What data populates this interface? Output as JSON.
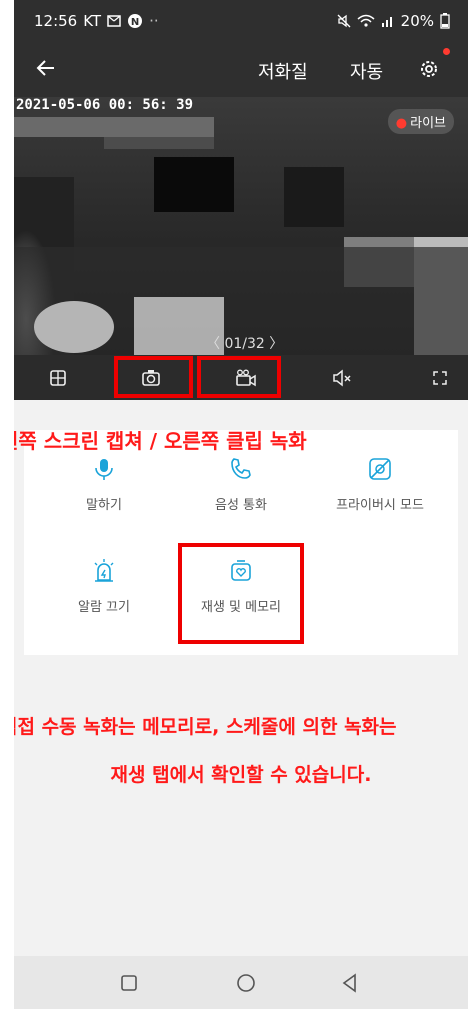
{
  "status_bar": {
    "time": "12:56",
    "carrier": "KT",
    "battery": "20%"
  },
  "nav": {
    "quality_label": "저화질",
    "auto_label": "자동"
  },
  "video": {
    "timestamp": "2021-05-06  00: 56: 39",
    "live_badge": "라이브",
    "clip_counter": "〈  01/32  〉"
  },
  "toolbar": {
    "icons": [
      "grid-icon",
      "camera-icon",
      "record-icon",
      "mute-icon",
      "fullscreen-icon"
    ]
  },
  "captions": {
    "capture_note": "왼쪽 스크린 캡쳐 / 오른쪽 클립 녹화",
    "memory_note": "직접 수동 녹화는 메모리로, 스케줄에 의한 녹화는",
    "playback_note": "재생 탭에서 확인할 수 있습니다."
  },
  "menu": {
    "items": [
      {
        "label": "말하기",
        "icon": "mic-icon"
      },
      {
        "label": "음성 통화",
        "icon": "phone-icon"
      },
      {
        "label": "프라이버시 모드",
        "icon": "privacy-icon"
      },
      {
        "label": "알람 끄기",
        "icon": "alarm-icon"
      },
      {
        "label": "재생 및 메모리",
        "icon": "playback-icon"
      }
    ]
  },
  "colors": {
    "accent": "#1aa3d9",
    "highlight_red": "#ee0000",
    "topbar": "#2f2f2f"
  }
}
